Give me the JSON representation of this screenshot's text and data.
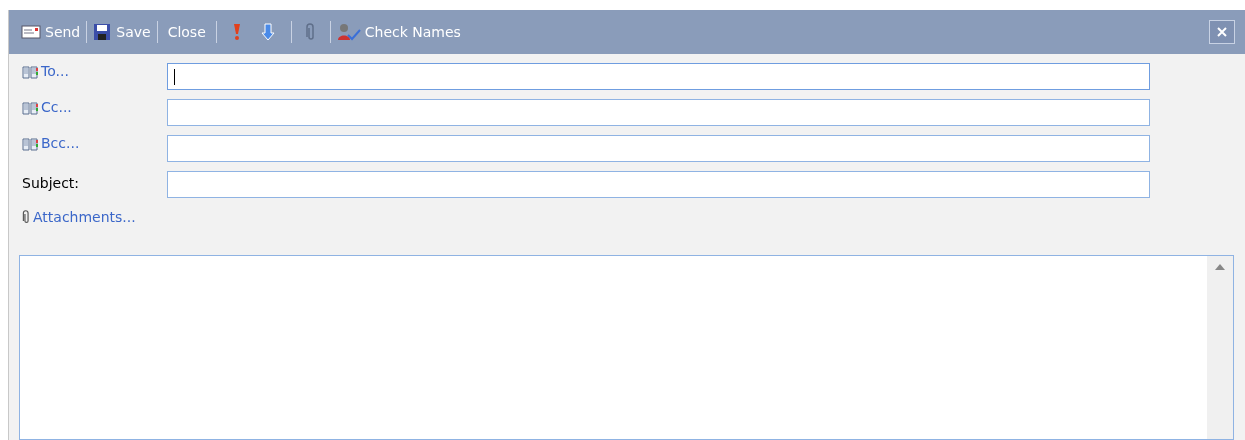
{
  "toolbar": {
    "send": "Send",
    "save": "Save",
    "close": "Close",
    "check_names": "Check Names"
  },
  "recipients": [
    {
      "label": "To...",
      "focused": true
    },
    {
      "label": "Cc...",
      "focused": false
    },
    {
      "label": "Bcc...",
      "focused": false
    }
  ],
  "subject": {
    "label": "Subject:",
    "focused": false
  },
  "attachments": "Attachments..."
}
